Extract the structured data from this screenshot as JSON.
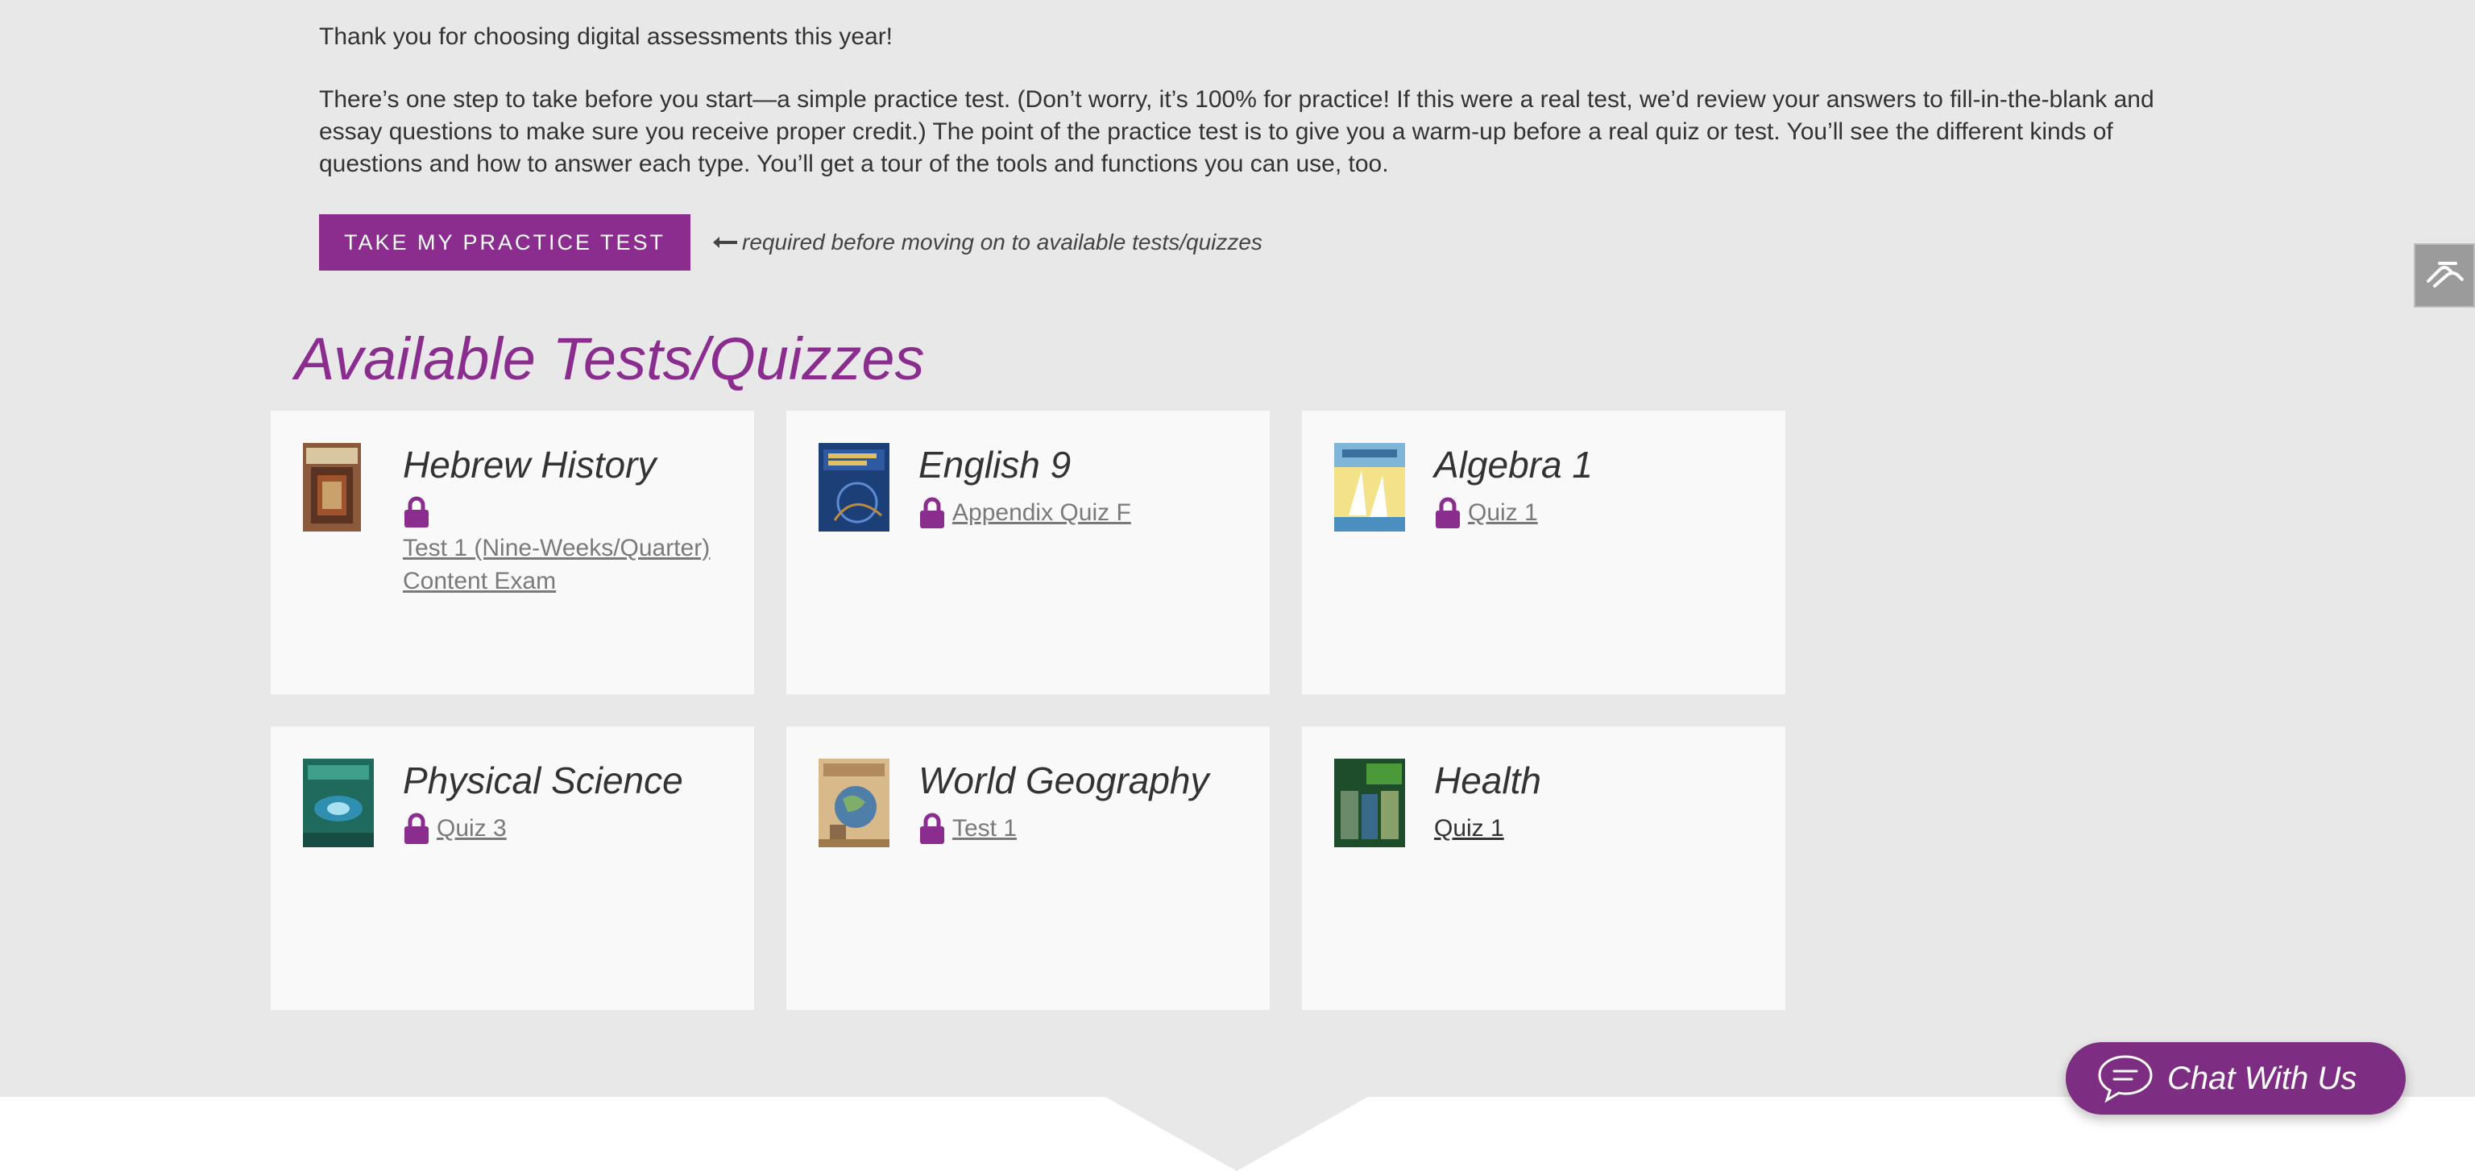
{
  "intro": {
    "thanks": "Thank you for choosing digital assessments this year!",
    "explanation": "There’s one step to take before you start—a simple practice test. (Don’t worry, it’s 100% for practice! If this were a real test, we’d review your answers to fill-in-the-blank and essay questions to make sure you receive proper credit.) The point of the practice test is to give you a warm-up before a real quiz or test. You’ll see the different kinds of questions and how to answer each type. You’ll get a tour of the tools and functions you can use, too."
  },
  "practice": {
    "button_label": "TAKE MY PRACTICE TEST",
    "note": "required before moving on to available tests/quizzes"
  },
  "section_title": "Available Tests/Quizzes",
  "courses": [
    {
      "title": "Hebrew History",
      "link": "Test 1 (Nine-Weeks/Quarter) Content Exam",
      "locked": true,
      "icon": "lock-icon"
    },
    {
      "title": "English 9",
      "link": "Appendix Quiz F",
      "locked": true,
      "icon": "lock-icon"
    },
    {
      "title": "Algebra 1",
      "link": "Quiz 1",
      "locked": true,
      "icon": "lock-icon"
    },
    {
      "title": "Physical Science",
      "link": "Quiz 3",
      "locked": true,
      "icon": "lock-icon"
    },
    {
      "title": "World Geography",
      "link": "Test 1",
      "locked": true,
      "icon": "lock-icon"
    },
    {
      "title": "Health",
      "link": "Quiz 1",
      "locked": false,
      "icon": ""
    }
  ],
  "chat": {
    "label": "Chat With Us",
    "icon": "chat-bubble-icon"
  },
  "side_tab": {
    "icon": "accessibility-hand-icon"
  },
  "colors": {
    "accent": "#8a2d8f",
    "chat": "#7d2e82",
    "background": "#e8e8e8",
    "card": "#f9f9f9"
  }
}
